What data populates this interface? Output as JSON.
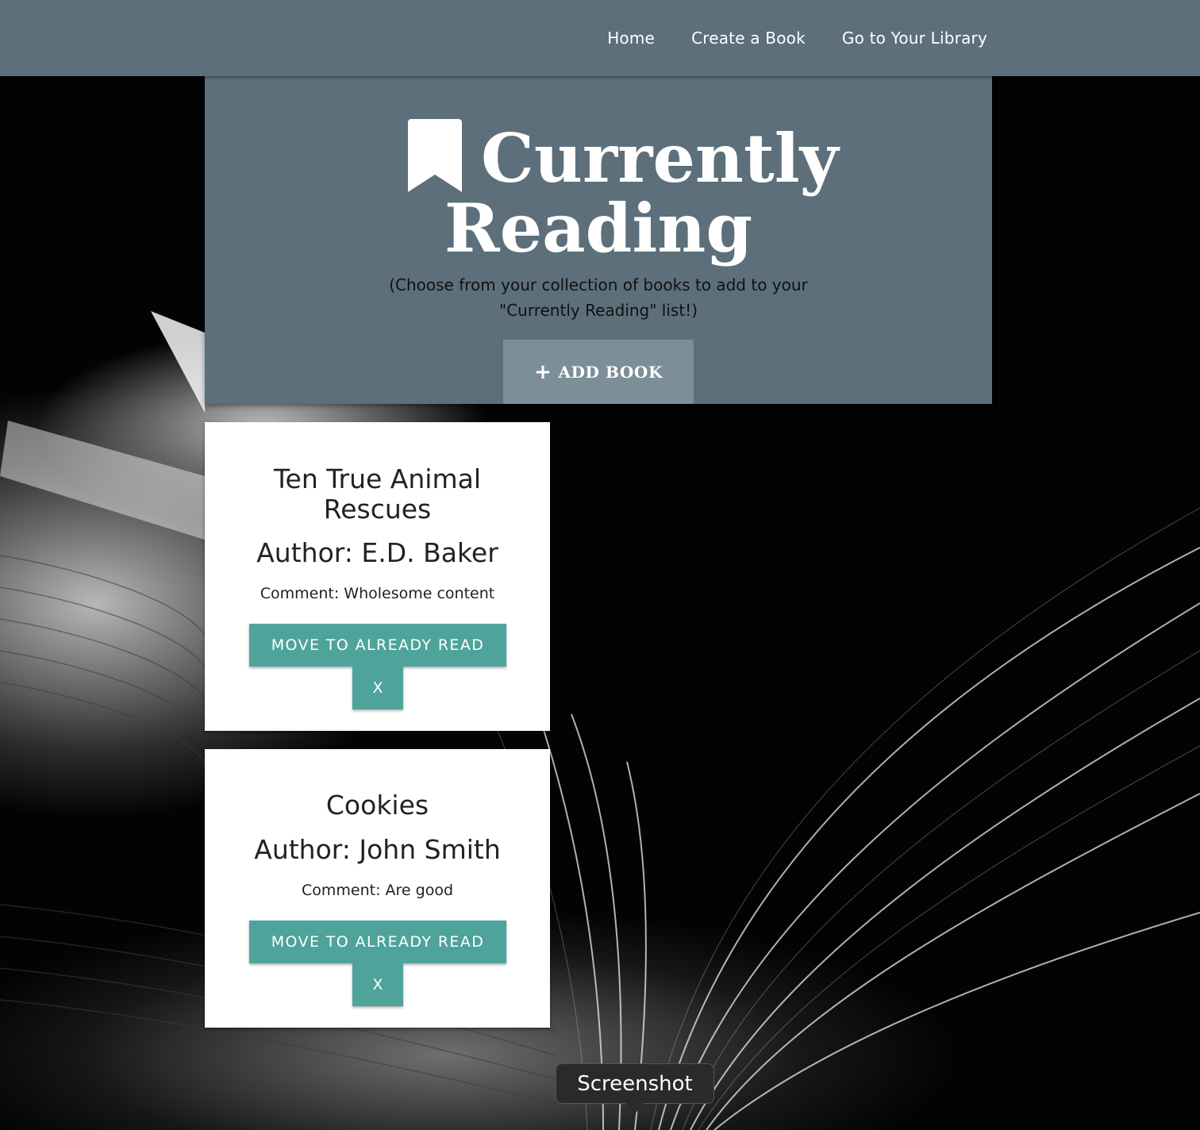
{
  "nav": {
    "items": [
      {
        "label": "Home"
      },
      {
        "label": "Create a Book"
      },
      {
        "label": "Go to Your Library"
      }
    ]
  },
  "hero": {
    "title_line1": "Currently",
    "title_line2": "Reading",
    "icon": "bookmark-icon",
    "subtitle": "(Choose from your collection of books to add to your \"Currently Reading\" list!)",
    "add_button_label": "ADD BOOK",
    "add_button_icon": "plus-icon"
  },
  "books": [
    {
      "title": "Ten True Animal Rescues",
      "author": "Author: E.D. Baker",
      "comment": "Comment: Wholesome content",
      "move_label": "MOVE TO ALREADY READ",
      "remove_label": "X"
    },
    {
      "title": "Cookies",
      "author": "Author: John Smith",
      "comment": "Comment: Are good",
      "move_label": "MOVE TO ALREADY READ",
      "remove_label": "X"
    }
  ],
  "tooltip": {
    "text": "Screenshot"
  },
  "colors": {
    "nav_bg": "#5c6f7a",
    "hero_bg": "#5c6f7a",
    "add_button_bg": "#7c8f99",
    "accent_teal": "#4ea49a",
    "card_bg": "#ffffff"
  }
}
